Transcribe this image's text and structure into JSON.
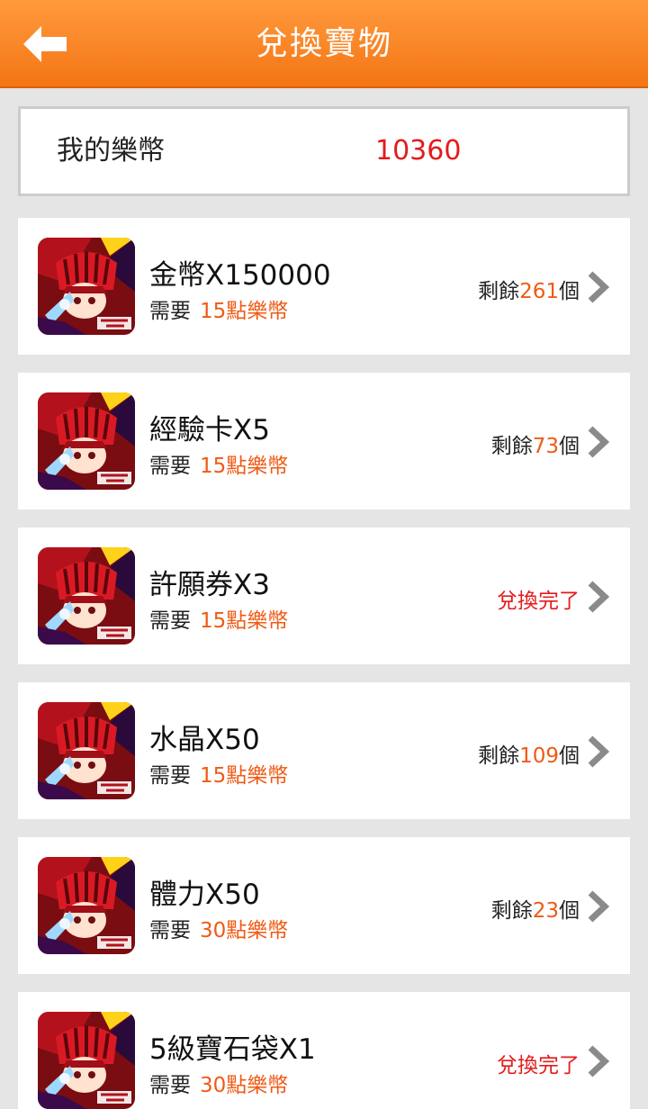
{
  "header": {
    "title": "兌換寶物",
    "back_icon": "back-arrow-icon"
  },
  "balance": {
    "label": "我的樂幣",
    "value": "10360"
  },
  "cost_prefix": "需要",
  "stock_prefix": "剩餘",
  "stock_suffix": "個",
  "colors": {
    "header": "#f47514",
    "accent": "#f05a14",
    "alert": "#e31b1b"
  },
  "items": [
    {
      "name": "金幣X150000",
      "cost": "15點樂幣",
      "stock": "261",
      "status": ""
    },
    {
      "name": "經驗卡X5",
      "cost": "15點樂幣",
      "stock": "73",
      "status": ""
    },
    {
      "name": "許願券X3",
      "cost": "15點樂幣",
      "stock": "",
      "status": "兌換完了"
    },
    {
      "name": "水晶X50",
      "cost": "15點樂幣",
      "stock": "109",
      "status": ""
    },
    {
      "name": "體力X50",
      "cost": "30點樂幣",
      "stock": "23",
      "status": ""
    },
    {
      "name": "5級寶石袋X1",
      "cost": "30點樂幣",
      "stock": "",
      "status": "兌換完了"
    }
  ]
}
